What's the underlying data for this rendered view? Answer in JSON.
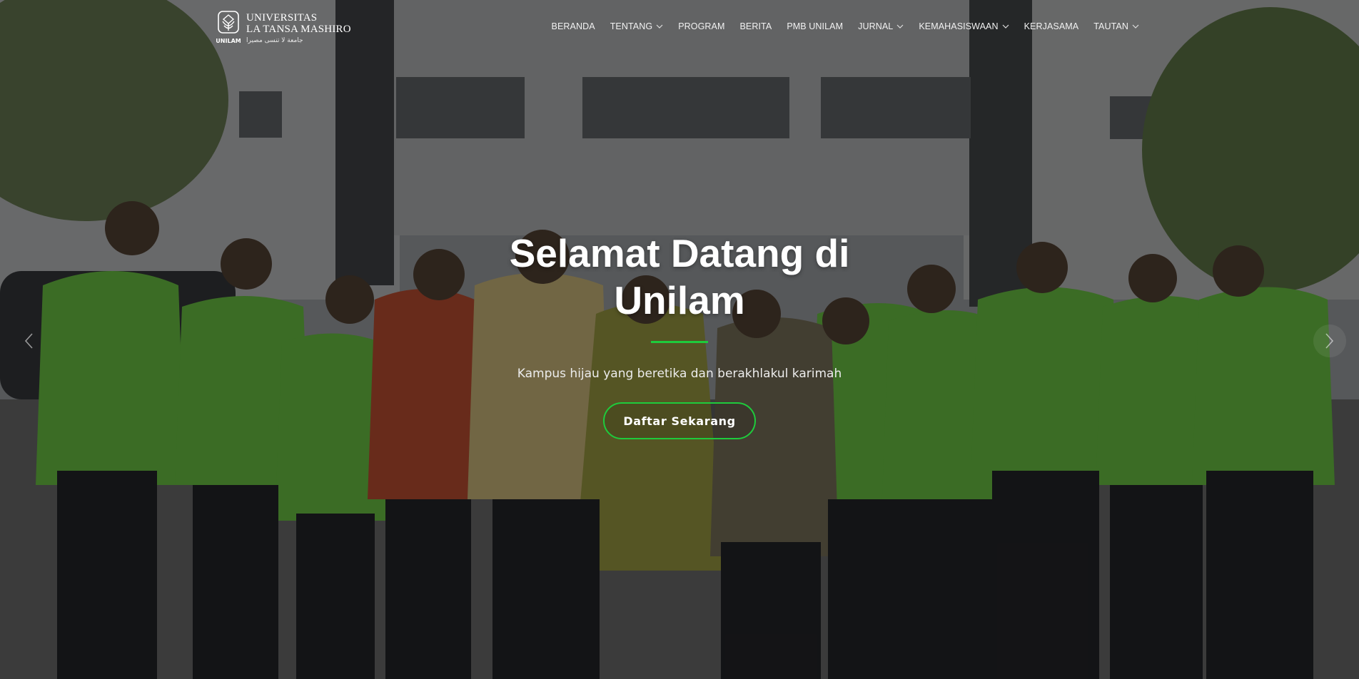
{
  "brand": {
    "line1": "UNIVERSITAS",
    "line2": "LA TANSA MASHIRO",
    "line3": "جامعة لا تنسى مصيرا",
    "mark_caption": "UNILAM",
    "accent_color": "#1ecb3c"
  },
  "nav": {
    "items": [
      {
        "label": "BERANDA",
        "dropdown": false
      },
      {
        "label": "TENTANG",
        "dropdown": true
      },
      {
        "label": "PROGRAM",
        "dropdown": false
      },
      {
        "label": "BERITA",
        "dropdown": false
      },
      {
        "label": "PMB UNILAM",
        "dropdown": false
      },
      {
        "label": "JURNAL",
        "dropdown": true
      },
      {
        "label": "KEMAHASISWAAN",
        "dropdown": true
      },
      {
        "label": "KERJASAMA",
        "dropdown": false
      },
      {
        "label": "TAUTAN",
        "dropdown": true
      }
    ]
  },
  "hero": {
    "title_line1": "Selamat Datang di",
    "title_line2": "Unilam",
    "subtitle": "Kampus hijau yang beretika dan berakhlakul karimah",
    "cta_label": "Daftar Sekarang"
  },
  "slider": {
    "prev_icon": "chevron-left-icon",
    "next_icon": "chevron-right-icon"
  }
}
